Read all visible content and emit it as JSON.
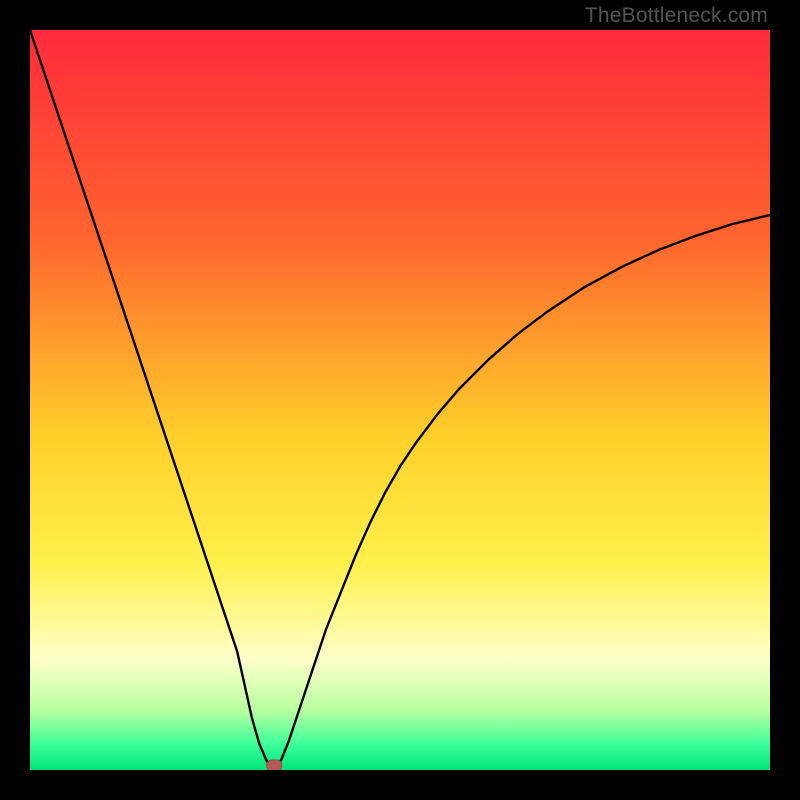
{
  "watermark": {
    "text": "TheBottleneck.com"
  },
  "colors": {
    "red": "#ff2a3c",
    "orange": "#ff8a2a",
    "yellow": "#ffe92a",
    "yellow2": "#fff56a",
    "cream": "#ffffc8",
    "lime": "#9aff7a",
    "green1": "#2cff88",
    "green2": "#00e47a",
    "curve": "#000000",
    "marker_fill": "#b55a55",
    "marker_stroke": "#9a4a45"
  },
  "chart_data": {
    "type": "line",
    "title": "",
    "xlabel": "",
    "ylabel": "",
    "xlim": [
      0,
      100
    ],
    "ylim": [
      0,
      100
    ],
    "annotations": [
      {
        "name": "minimum-marker",
        "x": 33,
        "y": 0
      }
    ],
    "series": [
      {
        "name": "bottleneck-curve",
        "x": [
          0,
          2,
          4,
          6,
          8,
          10,
          12,
          14,
          16,
          18,
          20,
          22,
          24,
          26,
          28,
          30,
          31,
          32,
          33,
          34,
          35,
          36,
          38,
          40,
          42,
          44,
          46,
          48,
          50,
          52,
          55,
          58,
          62,
          66,
          70,
          75,
          80,
          85,
          90,
          95,
          100
        ],
        "y": [
          100,
          94,
          88,
          82,
          76,
          70,
          64,
          58,
          52,
          46,
          40,
          34,
          28,
          22,
          16,
          7,
          3.5,
          1.2,
          0,
          1.5,
          4,
          7,
          13,
          19,
          24,
          29,
          33.5,
          37.5,
          41,
          44,
          48,
          51.5,
          55.5,
          59,
          62,
          65.3,
          68,
          70.3,
          72.2,
          73.8,
          75
        ]
      }
    ]
  }
}
